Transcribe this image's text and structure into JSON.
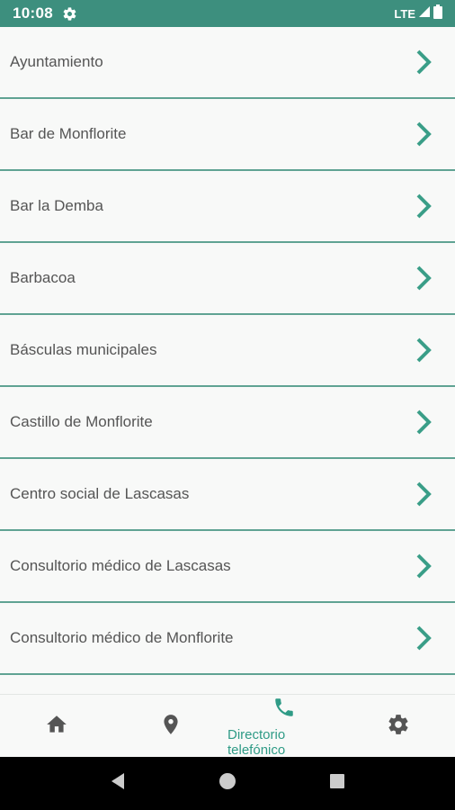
{
  "status_bar": {
    "time": "10:08",
    "network": "LTE",
    "icons": [
      "gear-icon",
      "signal-icon",
      "battery-icon"
    ]
  },
  "list": {
    "items": [
      {
        "label": "Ayuntamiento"
      },
      {
        "label": "Bar de Monflorite"
      },
      {
        "label": "Bar la Demba"
      },
      {
        "label": "Barbacoa"
      },
      {
        "label": "Básculas municipales"
      },
      {
        "label": "Castillo de Monflorite"
      },
      {
        "label": "Centro social de Lascasas"
      },
      {
        "label": "Consultorio médico de Lascasas"
      },
      {
        "label": "Consultorio médico de Monflorite"
      },
      {
        "label": ""
      }
    ]
  },
  "bottom_nav": {
    "items": [
      {
        "icon": "home-icon",
        "label": ""
      },
      {
        "icon": "location-pin-icon",
        "label": ""
      },
      {
        "icon": "phone-icon",
        "label": "Directorio telefónico",
        "active": true
      },
      {
        "icon": "settings-gear-icon",
        "label": ""
      }
    ]
  },
  "system_nav": {
    "icons": [
      "back-icon",
      "home-circle-icon",
      "recents-icon"
    ]
  },
  "colors": {
    "status_bar": "#3d8f7e",
    "accent": "#2f9b86",
    "divider": "#5fa393",
    "chevron": "#3a9e88",
    "text": "#555555",
    "nav_icon": "#555555"
  }
}
